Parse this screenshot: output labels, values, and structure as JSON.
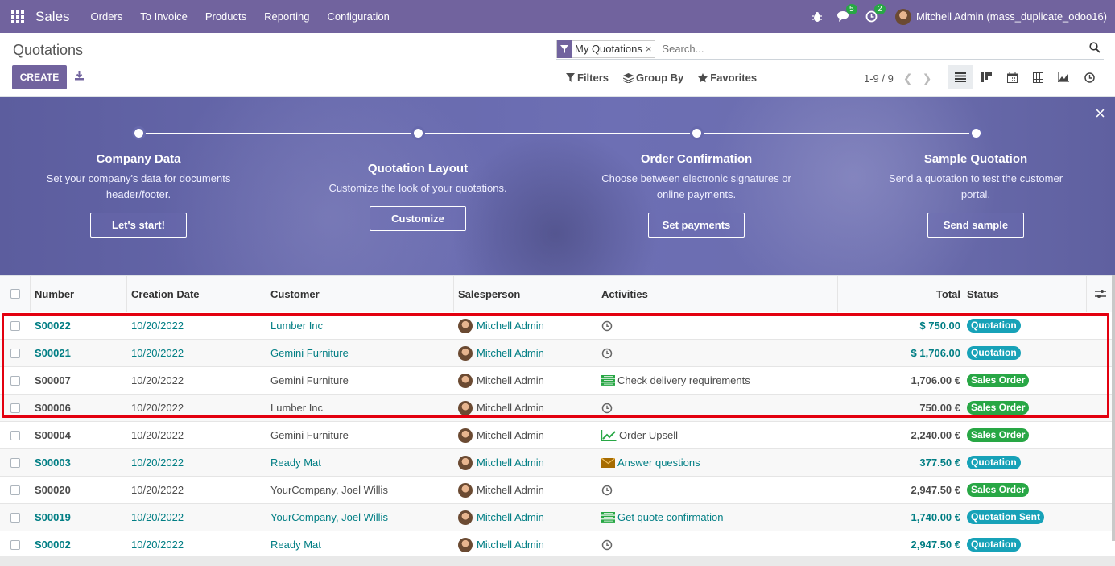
{
  "navbar": {
    "app_name": "Sales",
    "menu": [
      "Orders",
      "To Invoice",
      "Products",
      "Reporting",
      "Configuration"
    ],
    "messages_count": "5",
    "activities_count": "2",
    "user": "Mitchell Admin (mass_duplicate_odoo16)"
  },
  "control_panel": {
    "title": "Quotations",
    "create_label": "CREATE",
    "facet_label": "My Quotations",
    "facet_remove": "×",
    "search_placeholder": "Search...",
    "filters_label": "Filters",
    "group_by_label": "Group By",
    "favorites_label": "Favorites",
    "pager": "1-9 / 9"
  },
  "banner": {
    "steps": [
      {
        "title": "Company Data",
        "desc": "Set your company's data for documents header/footer.",
        "button": "Let's start!"
      },
      {
        "title": "Quotation Layout",
        "desc": "Customize the look of your quotations.",
        "button": "Customize"
      },
      {
        "title": "Order Confirmation",
        "desc": "Choose between electronic signatures or online payments.",
        "button": "Set payments"
      },
      {
        "title": "Sample Quotation",
        "desc": "Send a quotation to test the customer portal.",
        "button": "Send sample"
      }
    ],
    "close": "×"
  },
  "table": {
    "headers": [
      "Number",
      "Creation Date",
      "Customer",
      "Salesperson",
      "Activities",
      "Total",
      "Status"
    ],
    "rows": [
      {
        "number": "S00022",
        "date": "10/20/2022",
        "customer": "Lumber Inc",
        "salesperson": "Mitchell Admin",
        "activity": "",
        "activity_icon": "clock-icon",
        "total": "$ 750.00",
        "status": "Quotation",
        "status_kind": "quotation",
        "is_link": true
      },
      {
        "number": "S00021",
        "date": "10/20/2022",
        "customer": "Gemini Furniture",
        "salesperson": "Mitchell Admin",
        "activity": "",
        "activity_icon": "clock-icon",
        "total": "$ 1,706.00",
        "status": "Quotation",
        "status_kind": "quotation",
        "is_link": true
      },
      {
        "number": "S00007",
        "date": "10/20/2022",
        "customer": "Gemini Furniture",
        "salesperson": "Mitchell Admin",
        "activity": "Check delivery requirements",
        "activity_icon": "todo-list-icon",
        "total": "1,706.00 €",
        "status": "Sales Order",
        "status_kind": "sales-order",
        "is_link": false
      },
      {
        "number": "S00006",
        "date": "10/20/2022",
        "customer": "Lumber Inc",
        "salesperson": "Mitchell Admin",
        "activity": "",
        "activity_icon": "clock-icon",
        "total": "750.00 €",
        "status": "Sales Order",
        "status_kind": "sales-order",
        "is_link": false
      },
      {
        "number": "S00004",
        "date": "10/20/2022",
        "customer": "Gemini Furniture",
        "salesperson": "Mitchell Admin",
        "activity": "Order Upsell",
        "activity_icon": "upsell-chart-icon",
        "total": "2,240.00 €",
        "status": "Sales Order",
        "status_kind": "sales-order",
        "is_link": false
      },
      {
        "number": "S00003",
        "date": "10/20/2022",
        "customer": "Ready Mat",
        "salesperson": "Mitchell Admin",
        "activity": "Answer questions",
        "activity_icon": "envelope-icon",
        "total": "377.50 €",
        "status": "Quotation",
        "status_kind": "quotation",
        "is_link": true
      },
      {
        "number": "S00020",
        "date": "10/20/2022",
        "customer": "YourCompany, Joel Willis",
        "salesperson": "Mitchell Admin",
        "activity": "",
        "activity_icon": "clock-icon",
        "total": "2,947.50 €",
        "status": "Sales Order",
        "status_kind": "sales-order",
        "is_link": false
      },
      {
        "number": "S00019",
        "date": "10/20/2022",
        "customer": "YourCompany, Joel Willis",
        "salesperson": "Mitchell Admin",
        "activity": "Get quote confirmation",
        "activity_icon": "todo-list-icon",
        "total": "1,740.00 €",
        "status": "Quotation Sent",
        "status_kind": "sent",
        "is_link": true
      },
      {
        "number": "S00002",
        "date": "10/20/2022",
        "customer": "Ready Mat",
        "salesperson": "Mitchell Admin",
        "activity": "",
        "activity_icon": "clock-icon",
        "total": "2,947.50 €",
        "status": "Quotation",
        "status_kind": "quotation",
        "is_link": true
      }
    ]
  },
  "colors": {
    "brand": "#71639e",
    "link": "#017e84",
    "highlight": "#e3000f",
    "quotation_badge": "#17a2b8",
    "sales_order_badge": "#28a745"
  }
}
